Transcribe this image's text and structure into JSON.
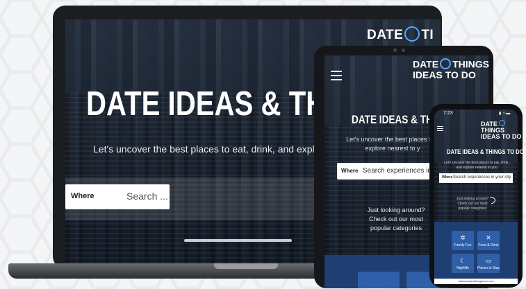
{
  "brand": {
    "logo_line1": "DATE",
    "logo_line2": "IDEAS",
    "logo_things": "THINGS",
    "logo_todo": "TO DO",
    "laptop_logo_text": "DATE",
    "laptop_logo_tail": "TI",
    "colors": {
      "accent": "#2f5fa8",
      "panel": "#1f3f73",
      "bulb": "#5aa9ff"
    }
  },
  "laptop": {
    "title": "DATE IDEAS & THING",
    "subtitle": "Let's uncover the best places to eat, drink, and expl",
    "search_label": "Where",
    "search_placeholder": "Search ..."
  },
  "tablet": {
    "title": "DATE IDEAS & THINGS",
    "subtitle": "Let's uncover the best places to e explore nearest to y",
    "search_label": "Where",
    "search_placeholder": "Search experiences in",
    "cta": "Just looking around? Check out our most popular categories"
  },
  "phone": {
    "time": "7:23",
    "status_icons": "▮ ◔ ▬",
    "title": "DATE IDEAS & THINGS TO DO",
    "subtitle": "Let's uncover the best places to eat, drink, and explore nearest to you",
    "search_label": "Where",
    "search_placeholder": "Search experiences in your city",
    "cta": "Just looking around? Check out our most popular categories",
    "categories": [
      {
        "label": "Family Fun",
        "icon": "sparkle-icon",
        "glyph": "✲"
      },
      {
        "label": "Food & Drink",
        "icon": "utensils-icon",
        "glyph": "✕"
      },
      {
        "label": "Nightlife",
        "icon": "moon-icon",
        "glyph": "☾"
      },
      {
        "label": "Places to Stay",
        "icon": "bed-icon",
        "glyph": "▭"
      }
    ],
    "footer": "dateideasandthingstodo.com"
  }
}
